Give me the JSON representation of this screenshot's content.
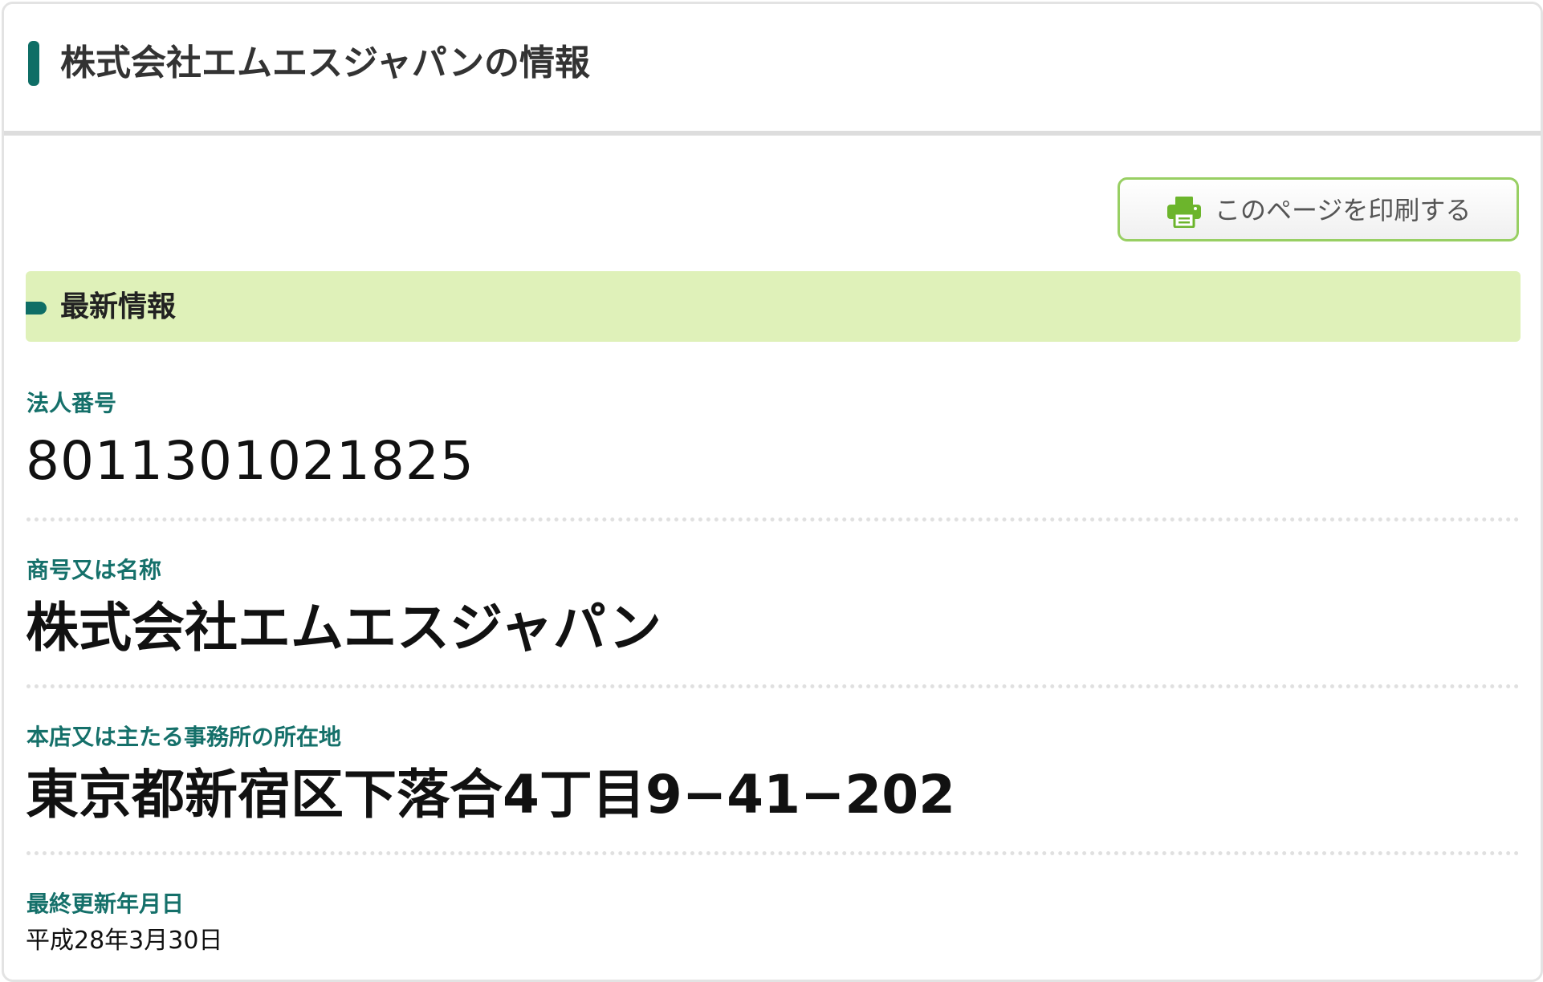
{
  "header": {
    "title": "株式会社エムエスジャパンの情報"
  },
  "toolbar": {
    "print_label": "このページを印刷する",
    "print_icon": "printer-icon"
  },
  "section": {
    "title": "最新情報"
  },
  "fields": {
    "corporate_number": {
      "label": "法人番号",
      "value": "8011301021825"
    },
    "trade_name": {
      "label": "商号又は名称",
      "value": "株式会社エムエスジャパン"
    },
    "address": {
      "label": "本店又は主たる事務所の所在地",
      "value": "東京都新宿区下落合4丁目9−41−202"
    },
    "last_updated": {
      "label": "最終更新年月日",
      "value": "平成28年3月30日"
    }
  },
  "colors": {
    "accent": "#0f6e66",
    "label_text": "#15706a",
    "band_background": "#dff1b9",
    "button_border": "#98cf63",
    "print_icon": "#6cb52c"
  }
}
